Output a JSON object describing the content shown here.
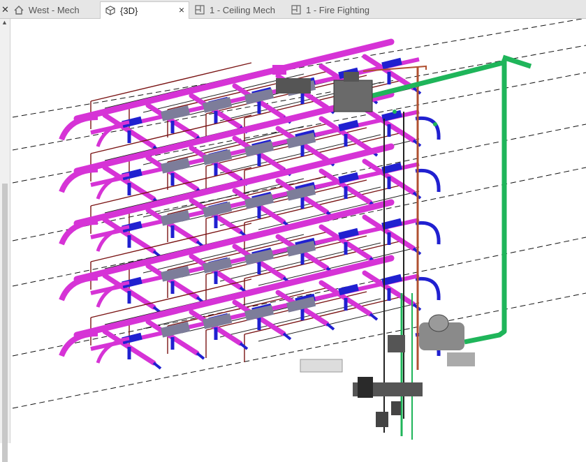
{
  "tabs": [
    {
      "label": "West - Mech",
      "icon": "elevation-view-icon",
      "active": false
    },
    {
      "label": "{3D}",
      "icon": "3d-view-icon",
      "active": true
    },
    {
      "label": "1 - Ceiling Mech",
      "icon": "floor-plan-view-icon",
      "active": false
    },
    {
      "label": "1 - Fire Fighting",
      "icon": "floor-plan-view-icon",
      "active": false
    }
  ],
  "close_label": "×",
  "colors": {
    "duct": "#d633d6",
    "diffuser": "#2020d0",
    "pipe_red": "#7a1414",
    "pipe_dark": "#222222",
    "pipe_green": "#1fb55a",
    "equipment": "#8a8a8a",
    "grid_line": "#111111"
  }
}
